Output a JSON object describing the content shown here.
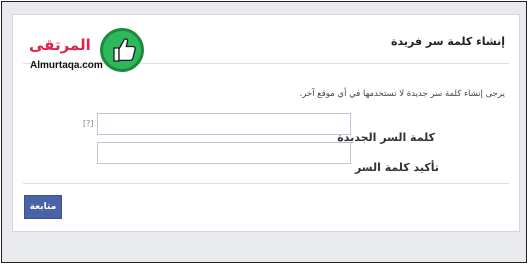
{
  "header": {
    "title": "إنشاء كلمة سر فريدة"
  },
  "form": {
    "instruction": "يرجى إنشاء كلمة سر جديدة لا تستخدمها في أي موقع آخر.",
    "new_password_label": "كلمة السر الجديدة",
    "confirm_password_label": "تأكيد كلمة السر",
    "help_marker": "[?]",
    "continue_label": "متابعة"
  },
  "watermark": {
    "arabic_text": "المرتقى",
    "latin_text": "Almurtaqa.com"
  },
  "colors": {
    "button_bg": "#4a62a6",
    "watermark_red": "#e0224b",
    "watermark_green": "#2eb85c"
  }
}
